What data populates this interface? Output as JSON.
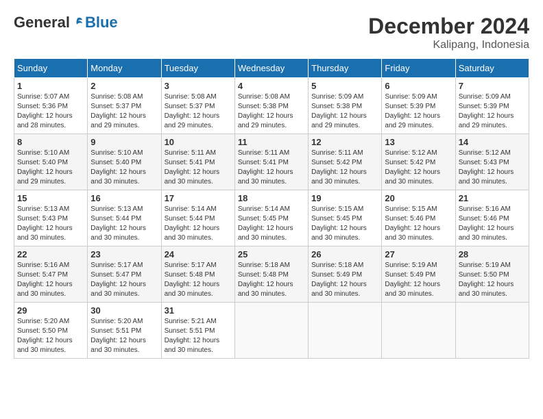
{
  "logo": {
    "general": "General",
    "blue": "Blue"
  },
  "title": {
    "month_year": "December 2024",
    "location": "Kalipang, Indonesia"
  },
  "calendar": {
    "headers": [
      "Sunday",
      "Monday",
      "Tuesday",
      "Wednesday",
      "Thursday",
      "Friday",
      "Saturday"
    ],
    "weeks": [
      [
        {
          "day": "",
          "detail": ""
        },
        {
          "day": "2",
          "detail": "Sunrise: 5:08 AM\nSunset: 5:37 PM\nDaylight: 12 hours\nand 29 minutes."
        },
        {
          "day": "3",
          "detail": "Sunrise: 5:08 AM\nSunset: 5:37 PM\nDaylight: 12 hours\nand 29 minutes."
        },
        {
          "day": "4",
          "detail": "Sunrise: 5:08 AM\nSunset: 5:38 PM\nDaylight: 12 hours\nand 29 minutes."
        },
        {
          "day": "5",
          "detail": "Sunrise: 5:09 AM\nSunset: 5:38 PM\nDaylight: 12 hours\nand 29 minutes."
        },
        {
          "day": "6",
          "detail": "Sunrise: 5:09 AM\nSunset: 5:39 PM\nDaylight: 12 hours\nand 29 minutes."
        },
        {
          "day": "7",
          "detail": "Sunrise: 5:09 AM\nSunset: 5:39 PM\nDaylight: 12 hours\nand 29 minutes."
        }
      ],
      [
        {
          "day": "1",
          "detail": "Sunrise: 5:07 AM\nSunset: 5:36 PM\nDaylight: 12 hours\nand 28 minutes.",
          "first_row": true
        },
        {
          "day": "",
          "detail": "",
          "empty": true
        },
        {
          "day": "",
          "detail": "",
          "empty": true
        },
        {
          "day": "",
          "detail": "",
          "empty": true
        },
        {
          "day": "",
          "detail": "",
          "empty": true
        },
        {
          "day": "",
          "detail": "",
          "empty": true
        },
        {
          "day": "",
          "detail": "",
          "empty": true
        }
      ],
      [
        {
          "day": "8",
          "detail": "Sunrise: 5:10 AM\nSunset: 5:40 PM\nDaylight: 12 hours\nand 29 minutes."
        },
        {
          "day": "9",
          "detail": "Sunrise: 5:10 AM\nSunset: 5:40 PM\nDaylight: 12 hours\nand 30 minutes."
        },
        {
          "day": "10",
          "detail": "Sunrise: 5:11 AM\nSunset: 5:41 PM\nDaylight: 12 hours\nand 30 minutes."
        },
        {
          "day": "11",
          "detail": "Sunrise: 5:11 AM\nSunset: 5:41 PM\nDaylight: 12 hours\nand 30 minutes."
        },
        {
          "day": "12",
          "detail": "Sunrise: 5:11 AM\nSunset: 5:42 PM\nDaylight: 12 hours\nand 30 minutes."
        },
        {
          "day": "13",
          "detail": "Sunrise: 5:12 AM\nSunset: 5:42 PM\nDaylight: 12 hours\nand 30 minutes."
        },
        {
          "day": "14",
          "detail": "Sunrise: 5:12 AM\nSunset: 5:43 PM\nDaylight: 12 hours\nand 30 minutes."
        }
      ],
      [
        {
          "day": "15",
          "detail": "Sunrise: 5:13 AM\nSunset: 5:43 PM\nDaylight: 12 hours\nand 30 minutes."
        },
        {
          "day": "16",
          "detail": "Sunrise: 5:13 AM\nSunset: 5:44 PM\nDaylight: 12 hours\nand 30 minutes."
        },
        {
          "day": "17",
          "detail": "Sunrise: 5:14 AM\nSunset: 5:44 PM\nDaylight: 12 hours\nand 30 minutes."
        },
        {
          "day": "18",
          "detail": "Sunrise: 5:14 AM\nSunset: 5:45 PM\nDaylight: 12 hours\nand 30 minutes."
        },
        {
          "day": "19",
          "detail": "Sunrise: 5:15 AM\nSunset: 5:45 PM\nDaylight: 12 hours\nand 30 minutes."
        },
        {
          "day": "20",
          "detail": "Sunrise: 5:15 AM\nSunset: 5:46 PM\nDaylight: 12 hours\nand 30 minutes."
        },
        {
          "day": "21",
          "detail": "Sunrise: 5:16 AM\nSunset: 5:46 PM\nDaylight: 12 hours\nand 30 minutes."
        }
      ],
      [
        {
          "day": "22",
          "detail": "Sunrise: 5:16 AM\nSunset: 5:47 PM\nDaylight: 12 hours\nand 30 minutes."
        },
        {
          "day": "23",
          "detail": "Sunrise: 5:17 AM\nSunset: 5:47 PM\nDaylight: 12 hours\nand 30 minutes."
        },
        {
          "day": "24",
          "detail": "Sunrise: 5:17 AM\nSunset: 5:48 PM\nDaylight: 12 hours\nand 30 minutes."
        },
        {
          "day": "25",
          "detail": "Sunrise: 5:18 AM\nSunset: 5:48 PM\nDaylight: 12 hours\nand 30 minutes."
        },
        {
          "day": "26",
          "detail": "Sunrise: 5:18 AM\nSunset: 5:49 PM\nDaylight: 12 hours\nand 30 minutes."
        },
        {
          "day": "27",
          "detail": "Sunrise: 5:19 AM\nSunset: 5:49 PM\nDaylight: 12 hours\nand 30 minutes."
        },
        {
          "day": "28",
          "detail": "Sunrise: 5:19 AM\nSunset: 5:50 PM\nDaylight: 12 hours\nand 30 minutes."
        }
      ],
      [
        {
          "day": "29",
          "detail": "Sunrise: 5:20 AM\nSunset: 5:50 PM\nDaylight: 12 hours\nand 30 minutes."
        },
        {
          "day": "30",
          "detail": "Sunrise: 5:20 AM\nSunset: 5:51 PM\nDaylight: 12 hours\nand 30 minutes."
        },
        {
          "day": "31",
          "detail": "Sunrise: 5:21 AM\nSunset: 5:51 PM\nDaylight: 12 hours\nand 30 minutes."
        },
        {
          "day": "",
          "detail": ""
        },
        {
          "day": "",
          "detail": ""
        },
        {
          "day": "",
          "detail": ""
        },
        {
          "day": "",
          "detail": ""
        }
      ]
    ]
  }
}
